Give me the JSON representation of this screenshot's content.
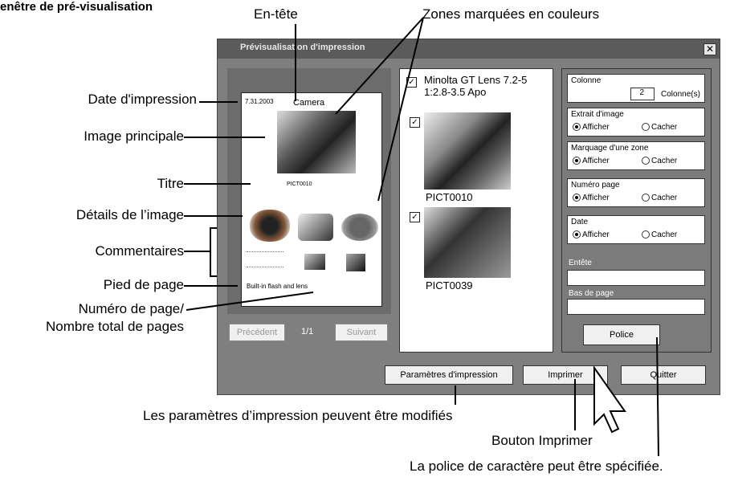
{
  "heading": "enêtre de pré-visualisation",
  "callouts": {
    "entete": "En-tête",
    "zones": "Zones marquées en couleurs",
    "date": "Date d'impression",
    "image_principale": "Image principale",
    "titre": "Titre",
    "details": "Détails de l’image",
    "commentaires": "Commentaires",
    "pied": "Pied de page",
    "numero1": "Numéro de page/",
    "numero2": "Nombre total de pages",
    "parametres": "Les paramètres d’impression peuvent être modifiés",
    "imprimer": "Bouton Imprimer",
    "police": "La police de caractère peut être spécifiée."
  },
  "dialog": {
    "title": "Prévisualisation d'impression",
    "preview": {
      "date": "7.31.2003",
      "header": "Camera",
      "title": "PICT0010",
      "footer": "Built-in flash and lens",
      "page_num": "1/1",
      "prev": "Précédent",
      "next": "Suivant"
    },
    "list": [
      {
        "caption": "Minolta GT Lens 7.2-5 1:2.8-3.5 Apo"
      },
      {
        "caption": "PICT0010"
      },
      {
        "caption": "PICT0039"
      }
    ],
    "options": {
      "colonne_label": "Colonne",
      "colonne_value": "2",
      "colonne_unit": "Colonne(s)",
      "extrait": "Extrait d'image",
      "marquage": "Marquage d'une zone",
      "numero": "Numéro page",
      "date": "Date",
      "afficher": "Afficher",
      "cacher": "Cacher",
      "entete": "Entête",
      "bas": "Bas de page",
      "police": "Police"
    },
    "buttons": {
      "parametres": "Paramètres d'impression",
      "imprimer": "Imprimer",
      "quitter": "Quitter"
    }
  }
}
